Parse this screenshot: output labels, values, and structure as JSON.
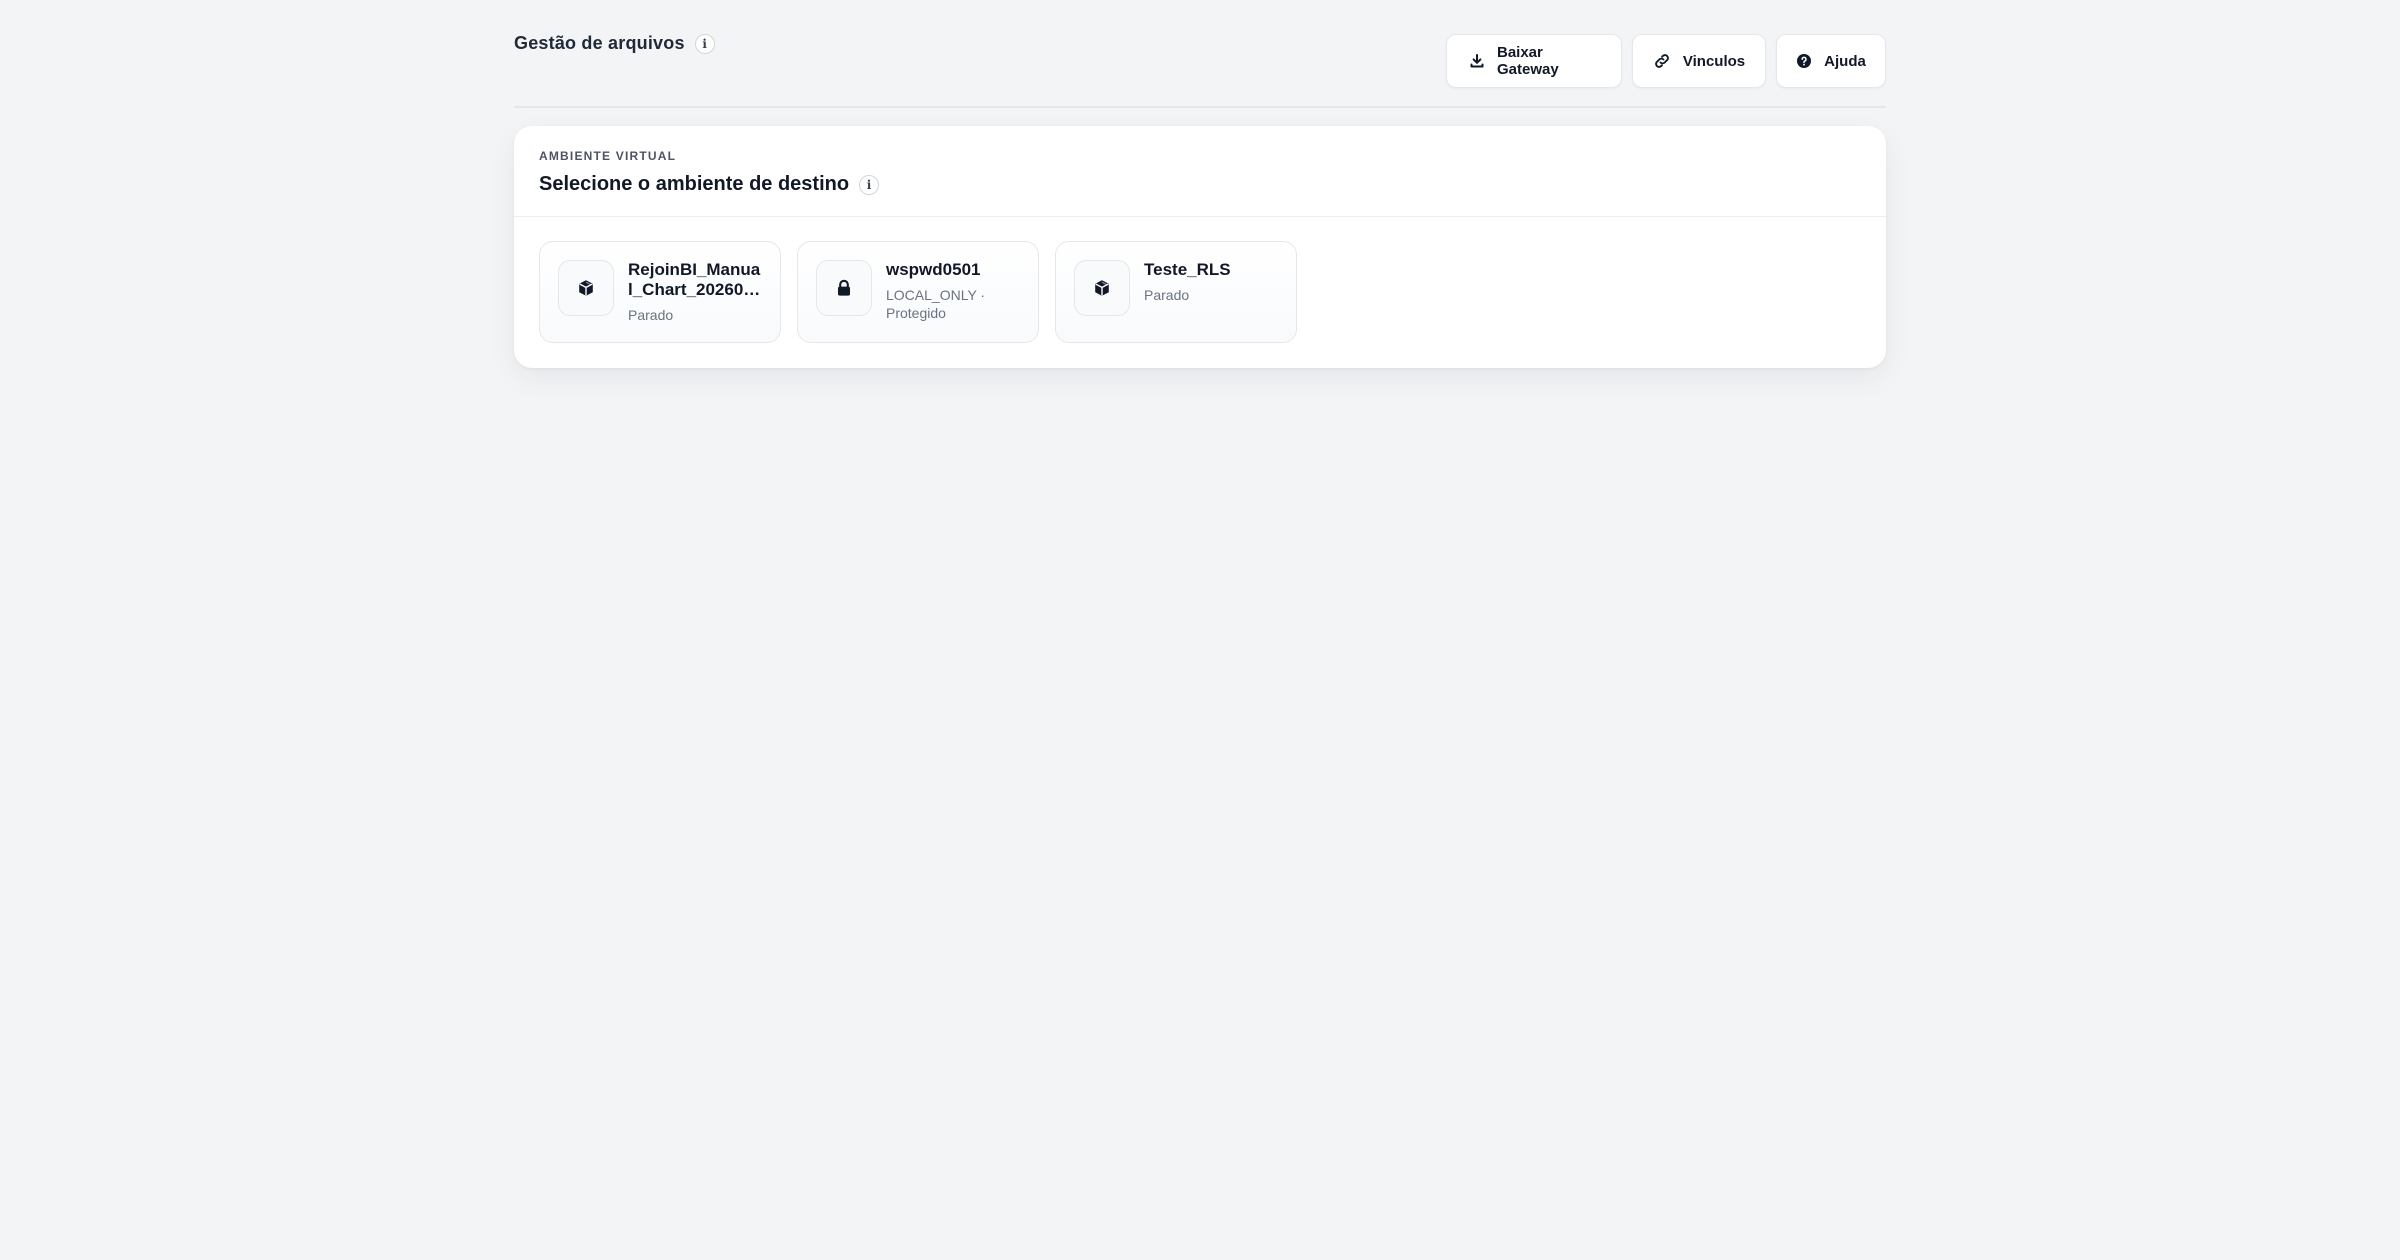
{
  "header": {
    "title": "Gestão de arquivos",
    "info_symbol": "i",
    "actions": {
      "gateway_label": "Baixar Gateway",
      "vinculos_label": "Vinculos",
      "ajuda_label": "Ajuda"
    }
  },
  "card": {
    "eyebrow": "AMBIENTE VIRTUAL",
    "title": "Selecione o ambiente de destino",
    "info_symbol": "i"
  },
  "environments": [
    {
      "name": "RejoinBI_Manual_Chart_20260…",
      "status": "Parado",
      "icon": "cube-icon"
    },
    {
      "name": "wspwd0501",
      "status": "LOCAL_ONLY · Protegido",
      "icon": "lock-icon"
    },
    {
      "name": "Teste_RLS",
      "status": "Parado",
      "icon": "cube-icon"
    }
  ],
  "colors": {
    "background": "#f3f4f6",
    "card": "#ffffff",
    "text": "#111827",
    "muted": "#6b7280",
    "border": "#e5e7eb"
  }
}
